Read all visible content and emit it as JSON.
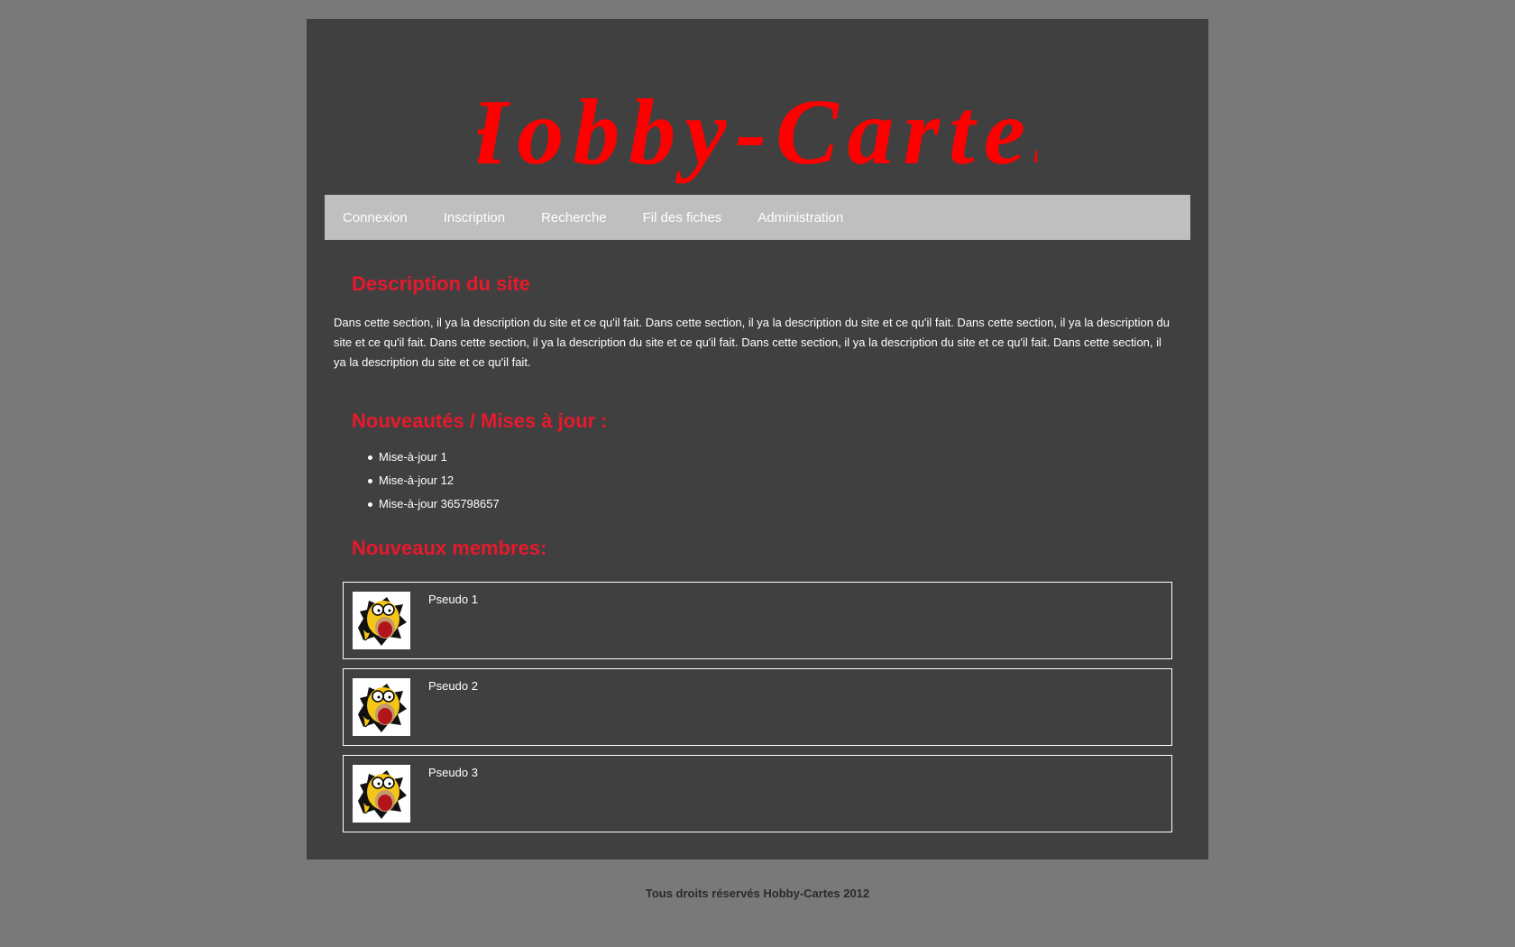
{
  "site": {
    "logo_text": "Hobby-Cartes",
    "logo_color": "#ff0000"
  },
  "nav": {
    "items": [
      {
        "label": "Connexion"
      },
      {
        "label": "Inscription"
      },
      {
        "label": "Recherche"
      },
      {
        "label": "Fil des fiches"
      },
      {
        "label": "Administration"
      }
    ]
  },
  "description": {
    "heading": "Description du site",
    "text": "Dans cette section, il ya la description du site et ce qu'il fait. Dans cette section, il ya la description du site et ce qu'il fait. Dans cette section, il ya la description du site et ce qu'il fait. Dans cette section, il ya la description du site et ce qu'il fait. Dans cette section, il ya la description du site et ce qu'il fait. Dans cette section, il ya la description du site et ce qu'il fait."
  },
  "updates": {
    "heading": "Nouveautés / Mises à jour :",
    "items": [
      "Mise-à-jour 1",
      "Mise-à-jour 12",
      "Mise-à-jour 365798657"
    ]
  },
  "members": {
    "heading": "Nouveaux membres:",
    "items": [
      {
        "pseudo": "Pseudo 1",
        "avatar_icon": "homer-avatar-icon"
      },
      {
        "pseudo": "Pseudo 2",
        "avatar_icon": "homer-avatar-icon"
      },
      {
        "pseudo": "Pseudo 3",
        "avatar_icon": "homer-avatar-icon"
      }
    ]
  },
  "footer": {
    "text": "Tous droits réservés Hobby-Cartes 2012"
  },
  "colors": {
    "page_bg": "#797979",
    "container_bg": "#404040",
    "nav_bg": "#bfbfbf",
    "heading": "#e8192c",
    "text": "#ffffff"
  }
}
